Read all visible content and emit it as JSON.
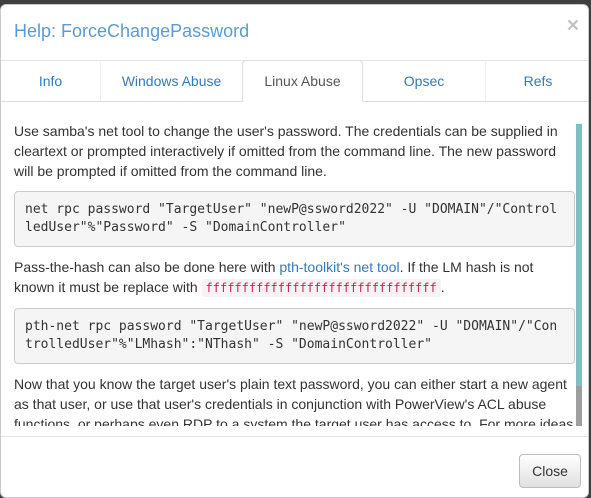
{
  "modal": {
    "title": "Help: ForceChangePassword",
    "close_glyph": "×"
  },
  "tabs": [
    {
      "label": "Info"
    },
    {
      "label": "Windows Abuse"
    },
    {
      "label": "Linux Abuse"
    },
    {
      "label": "Opsec"
    },
    {
      "label": "Refs"
    }
  ],
  "active_tab": "Linux Abuse",
  "content": {
    "para1": "Use samba's net tool to change the user's password. The credentials can be supplied in cleartext or prompted interactively if omitted from the command line. The new password will be prompted if omitted from the command line.",
    "code1": "net rpc password \"TargetUser\" \"newP@ssword2022\" -U \"DOMAIN\"/\"ControlledUser\"%\"Password\" -S \"DomainController\"",
    "para2_before": "Pass-the-hash can also be done here with ",
    "para2_link": "pth-toolkit's net tool",
    "para2_after": ". If the LM hash is not known it must be replace with ",
    "para2_code": "ffffffffffffffffffffffffffffffff",
    "para2_end": ".",
    "code2": "pth-net rpc password \"TargetUser\" \"newP@ssword2022\" -U \"DOMAIN\"/\"ControlledUser\"%\"LMhash\":\"NThash\" -S \"DomainController\"",
    "para3": "Now that you know the target user's plain text password, you can either start a new agent as that user, or use that user's credentials in conjunction with PowerView's ACL abuse functions, or perhaps even RDP to a system the target user has access to. For more ideas"
  },
  "footer": {
    "close_label": "Close"
  },
  "colors": {
    "title": "#5b9bd5",
    "link": "#337ab7",
    "inline_code": "#c7254e",
    "scroll_thumb": "#7fbfbf"
  }
}
